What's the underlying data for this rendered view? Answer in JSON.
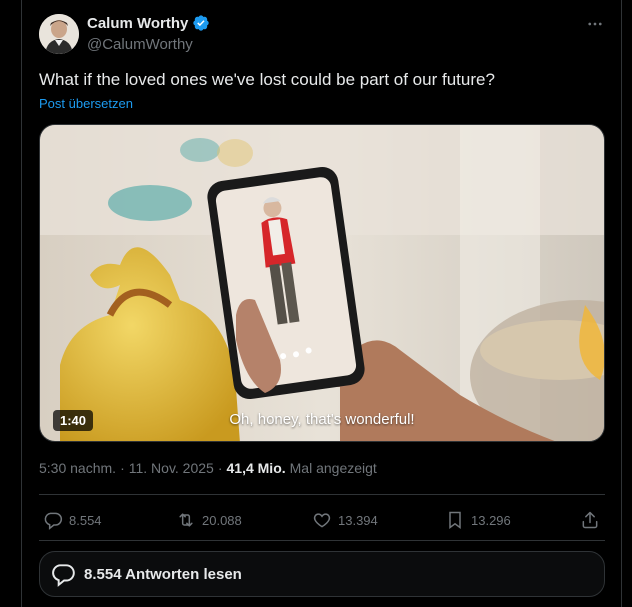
{
  "post": {
    "author_name": "Calum Worthy",
    "author_handle": "@CalumWorthy",
    "text": "What if the loved ones we've lost could be part of our future?",
    "translate_label": "Post übersetzen"
  },
  "media": {
    "duration": "1:40",
    "subtitle": "Oh, honey, that's wonderful!"
  },
  "meta": {
    "time": "5:30 nachm.",
    "separator1": "·",
    "date": "11. Nov. 2025",
    "separator2": "·",
    "views": "41,4 Mio.",
    "views_label": "Mal angezeigt"
  },
  "actions": {
    "replies": "8.554",
    "reposts": "20.088",
    "likes": "13.394",
    "bookmarks": "13.296"
  },
  "replies_button": {
    "label": "8.554 Antworten lesen"
  },
  "colors": {
    "background": "#000000",
    "text": "#e7e9ea",
    "muted": "#71767b",
    "link": "#1d9bf0",
    "border": "#2f3336",
    "verified": "#1d9bf0"
  },
  "icons": [
    "verified-badge-icon",
    "more-icon",
    "reply-icon",
    "repost-icon",
    "like-icon",
    "bookmark-icon",
    "share-icon",
    "chat-bubble-icon"
  ]
}
